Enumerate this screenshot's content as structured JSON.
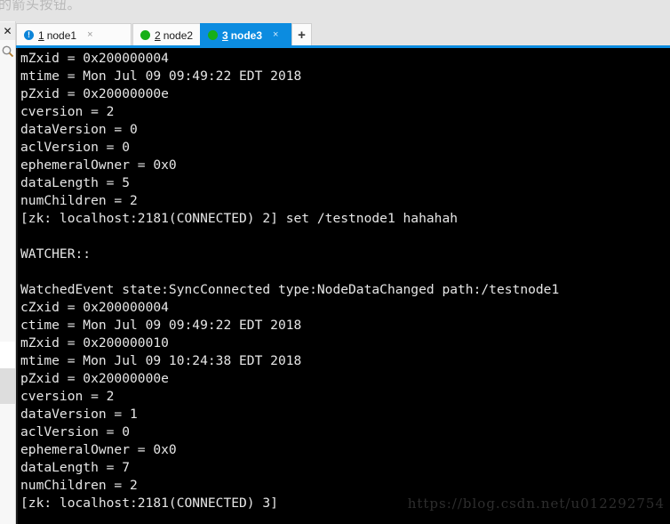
{
  "page_caption": "的箭头按钮。",
  "gutter": {
    "close_icon_label": "✕",
    "search_icon_name": "search-icon"
  },
  "tabbar": {
    "add_tab_label": "+",
    "close_glyph": "×",
    "tabs": [
      {
        "number": "1",
        "label": "node1",
        "status": "alert",
        "status_glyph": "!",
        "active": false
      },
      {
        "number": "2",
        "label": "node2",
        "status": "green",
        "status_glyph": "",
        "active": false
      },
      {
        "number": "3",
        "label": "node3",
        "status": "green",
        "status_glyph": "",
        "active": true
      }
    ]
  },
  "terminal": {
    "lines": [
      "mZxid = 0x200000004",
      "mtime = Mon Jul 09 09:49:22 EDT 2018",
      "pZxid = 0x20000000e",
      "cversion = 2",
      "dataVersion = 0",
      "aclVersion = 0",
      "ephemeralOwner = 0x0",
      "dataLength = 5",
      "numChildren = 2",
      "[zk: localhost:2181(CONNECTED) 2] set /testnode1 hahahah",
      "",
      "WATCHER::",
      "",
      "WatchedEvent state:SyncConnected type:NodeDataChanged path:/testnode1",
      "cZxid = 0x200000004",
      "ctime = Mon Jul 09 09:49:22 EDT 2018",
      "mZxid = 0x200000010",
      "mtime = Mon Jul 09 10:24:38 EDT 2018",
      "pZxid = 0x20000000e",
      "cversion = 2",
      "dataVersion = 1",
      "aclVersion = 0",
      "ephemeralOwner = 0x0",
      "dataLength = 7",
      "numChildren = 2",
      "[zk: localhost:2181(CONNECTED) 3]"
    ]
  },
  "watermark": "https://blog.csdn.net/u012292754",
  "colors": {
    "accent_blue": "#0c8ce0",
    "status_green": "#17af17",
    "terminal_bg": "#000000",
    "terminal_fg": "#e6e6e6",
    "chrome_bg": "#e4e4e4"
  }
}
